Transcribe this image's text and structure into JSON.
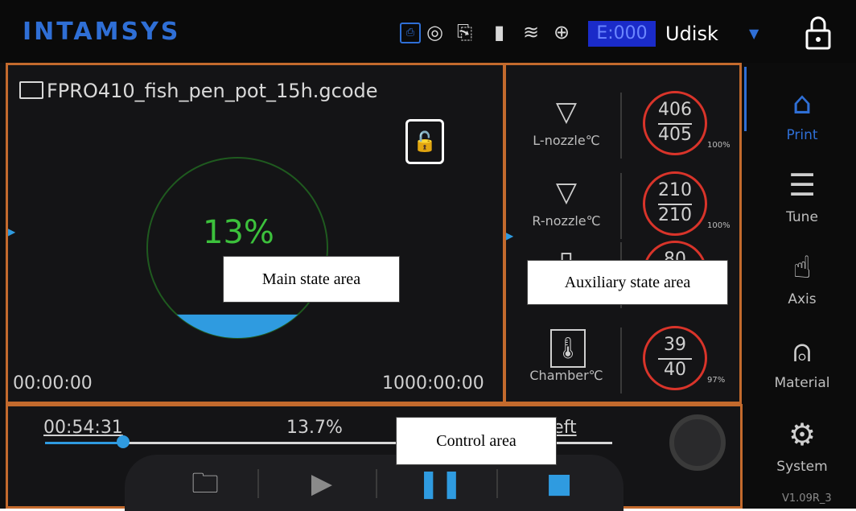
{
  "topbar": {
    "logo": "INTAMSYS",
    "error_code": "E:000",
    "storage_select": "Udisk",
    "status_icons": [
      "usb-icon",
      "camera-icon",
      "network-icon",
      "flash-drive-icon",
      "wifi-icon",
      "globe-icon"
    ]
  },
  "main": {
    "file_name": "FPRO410_fish_pen_pot_15h.gcode",
    "progress_percent": "13%",
    "progress_fraction": 0.13,
    "elapsed": "00:00:00",
    "total": "1000:00:00"
  },
  "aux": {
    "rows": [
      {
        "label": "L-nozzle℃",
        "actual": "406",
        "target": "405",
        "pct": "100%"
      },
      {
        "label": "R-nozzle℃",
        "actual": "210",
        "target": "210",
        "pct": "100%"
      },
      {
        "label": "",
        "actual": "80",
        "target": "",
        "pct": ""
      },
      {
        "label": "Chamber℃",
        "actual": "39",
        "target": "40",
        "pct": "97%"
      }
    ]
  },
  "nav": {
    "items": [
      {
        "label": "Print",
        "icon": "home-icon"
      },
      {
        "label": "Tune",
        "icon": "sliders-icon"
      },
      {
        "label": "Axis",
        "icon": "hand-icon"
      },
      {
        "label": "Material",
        "icon": "filament-icon"
      },
      {
        "label": "System",
        "icon": "gear-icon"
      }
    ],
    "version": "V1.09R_3"
  },
  "control": {
    "time": "00:54:31",
    "percent": "13.7%",
    "remaining": "7 left",
    "progress_fraction": 0.137
  },
  "callouts": {
    "main": "Main state area",
    "aux": "Auxiliary state area",
    "control": "Control area"
  },
  "colors": {
    "accent": "#2f6fd6",
    "progress": "#2f9be0",
    "percent_green": "#3cc13c",
    "frame": "#c36a2d",
    "temp_ring": "#d9342a"
  }
}
